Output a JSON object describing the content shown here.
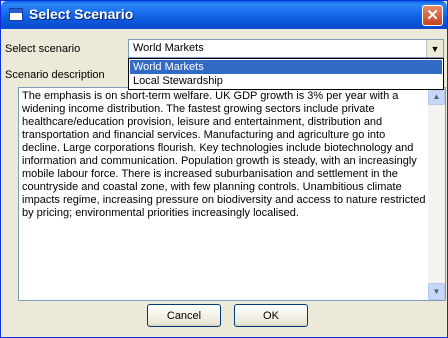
{
  "window": {
    "title": "Select Scenario",
    "close_glyph": "✕"
  },
  "form": {
    "scenario_label": "Select scenario",
    "description_label": "Scenario description",
    "scenario_selected": "World Markets",
    "scenario_options": [
      "World Markets",
      "Local Stewardship"
    ],
    "description_text": "The emphasis is on short-term welfare. UK  GDP growth is 3% per year with a widening income distribution. The fastest growing sectors include private healthcare/education provision, leisure and entertainment, distribution and transportation and financial services. Manufacturing and agriculture go into decline. Large corporations flourish. Key technologies include biotechnology and information and communication. Population growth is steady, with an increasingly mobile labour force. There is increased suburbanisation and settlement in the countryside and coastal zone, with few planning controls. Unambitious climate impacts regime, increasing pressure on biodiversity and access to nature restricted by pricing; environmental priorities increasingly localised."
  },
  "buttons": {
    "cancel": "Cancel",
    "ok": "OK"
  },
  "icons": {
    "window": "window-icon",
    "close": "close-icon",
    "dropdown": "chevron-down-icon",
    "scroll_up": "scroll-up-arrow-icon",
    "scroll_down": "scroll-down-arrow-icon"
  },
  "colors": {
    "titlebar": "#0a5fe6",
    "dialog_bg": "#ece9d8",
    "selection": "#316ac5",
    "close_button": "#c4421f"
  }
}
